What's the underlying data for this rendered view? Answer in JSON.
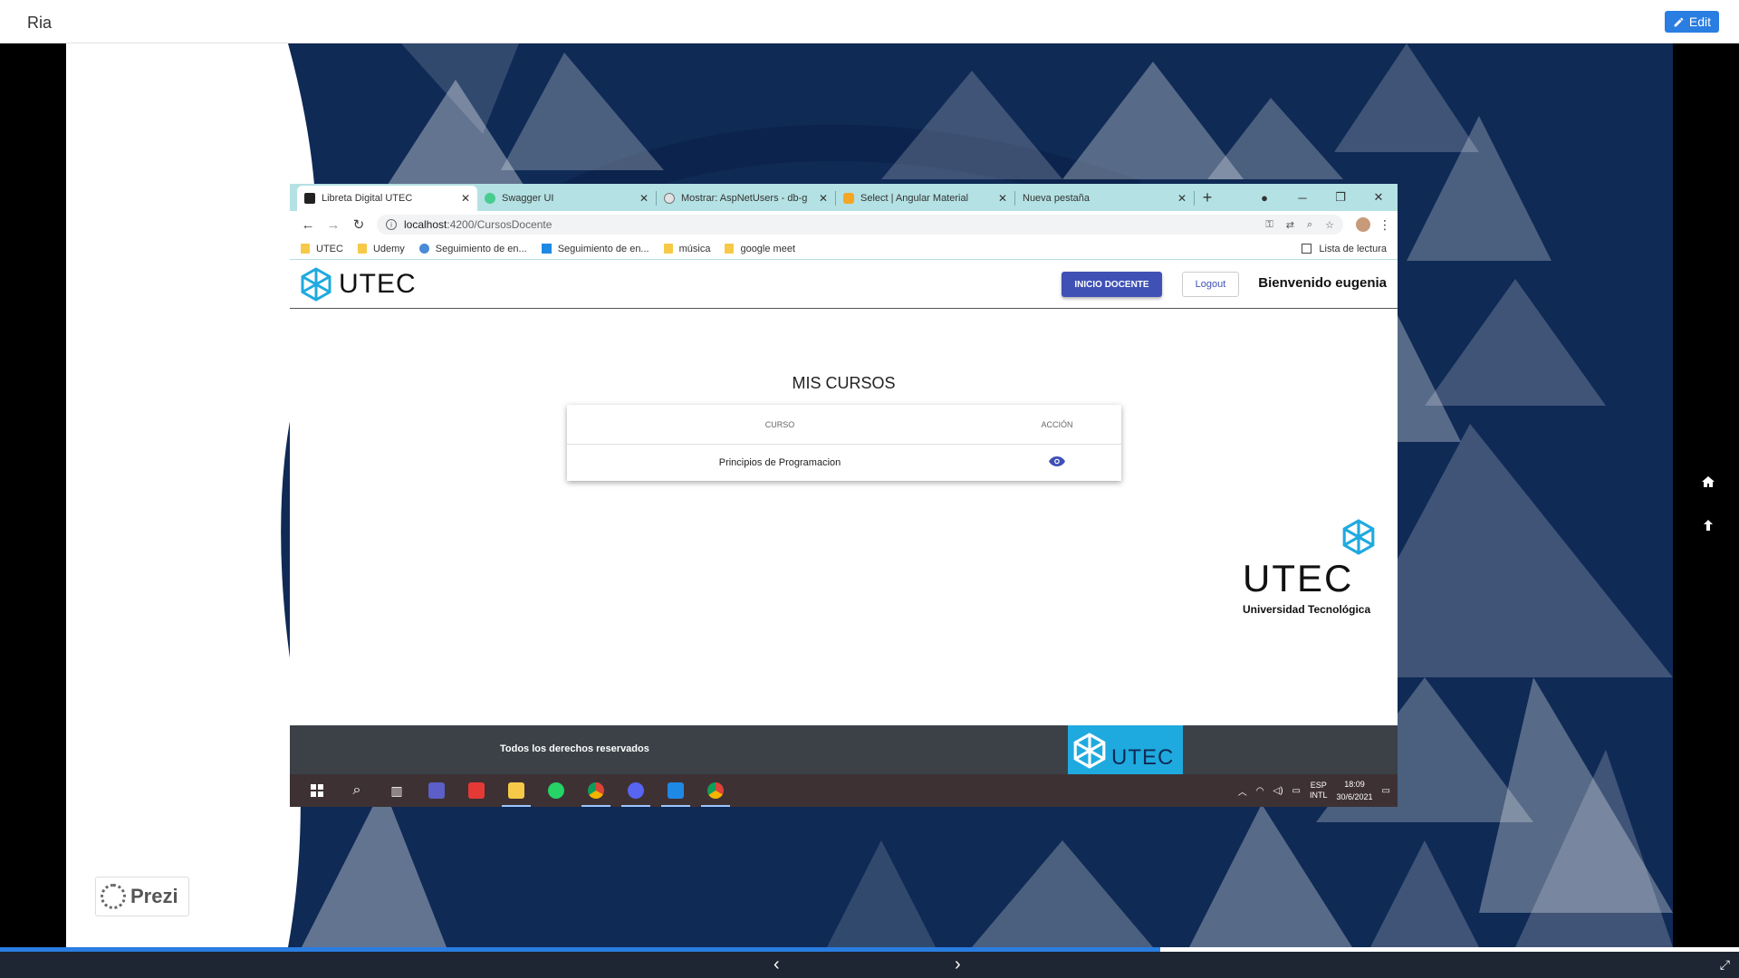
{
  "prezi": {
    "title": "Ria",
    "edit_label": "Edit",
    "logo_text": "Prezi",
    "progress": 0.667
  },
  "browser": {
    "tabs": [
      {
        "label": "Libreta Digital UTEC",
        "icon": "angular-icon",
        "active": true
      },
      {
        "label": "Swagger UI",
        "icon": "swagger-icon"
      },
      {
        "label": "Mostrar: AspNetUsers - db-g",
        "icon": "db-icon"
      },
      {
        "label": "Select | Angular Material",
        "icon": "shield-icon"
      },
      {
        "label": "Nueva pestaña",
        "icon": "none"
      }
    ],
    "url_host": "localhost",
    "url_path": ":4200/CursosDocente",
    "bookmarks": [
      {
        "label": "UTEC",
        "icon": "folder-icon"
      },
      {
        "label": "Udemy",
        "icon": "folder-icon"
      },
      {
        "label": "Seguimiento de en...",
        "icon": "globe-icon"
      },
      {
        "label": "Seguimiento de en...",
        "icon": "chart-icon"
      },
      {
        "label": "música",
        "icon": "folder-icon"
      },
      {
        "label": "google meet",
        "icon": "folder-icon"
      }
    ],
    "reading_list": "Lista de lectura"
  },
  "app": {
    "logo_text": "UTEC",
    "inicio_label": "INICIO DOCENTE",
    "logout_label": "Logout",
    "welcome": "Bienvenido eugenia",
    "page_title": "MIS CURSOS",
    "table": {
      "headers": [
        "CURSO",
        "ACCIÓN"
      ],
      "rows": [
        {
          "curso": "Principios de Programacion",
          "accion": "view-icon"
        }
      ]
    },
    "big_logo_text": "UTEC",
    "big_logo_sub": "Universidad Tecnológica",
    "footer_text": "Todos los derechos reservados",
    "footer_logo_text": "UTEC"
  },
  "taskbar": {
    "lang": "ESP",
    "lang2": "INTL",
    "time": "18:09",
    "date": "30/6/2021"
  },
  "colors": {
    "accent": "#3f51b5",
    "utec_blue": "#1faadf",
    "stage_bg": "#0f2a55",
    "tabbar": "#b4e1e3"
  }
}
